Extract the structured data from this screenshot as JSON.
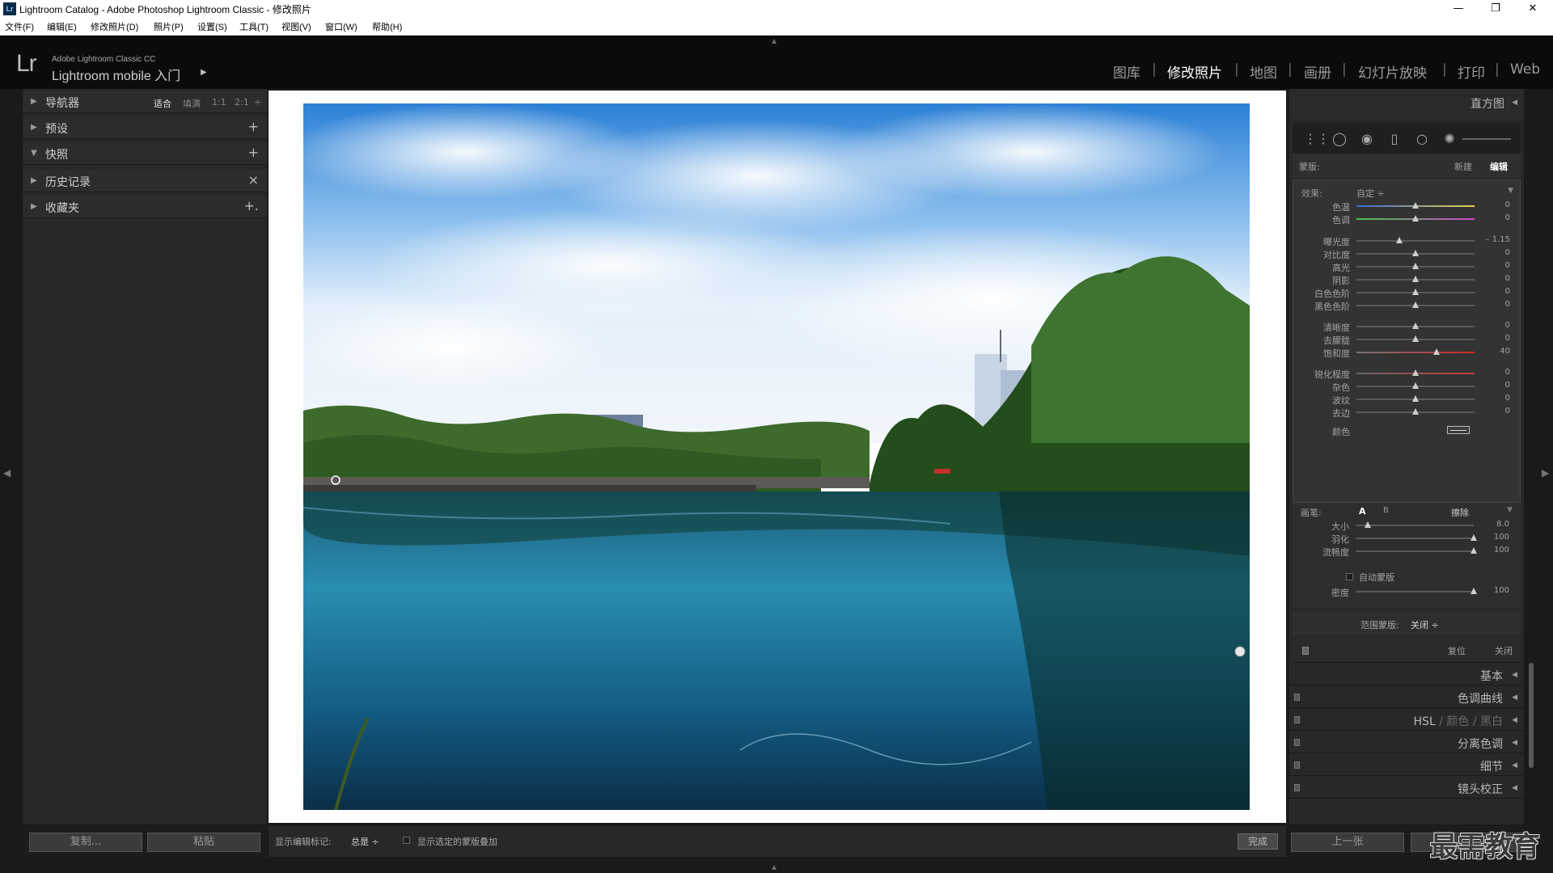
{
  "window": {
    "title": "Lightroom Catalog - Adobe Photoshop Lightroom Classic - 修改照片",
    "app_icon": "Lr",
    "minimize": "—",
    "maximize": "❐",
    "close": "✕"
  },
  "menubar": [
    "文件(F)",
    "编辑(E)",
    "修改照片(D)",
    "照片(P)",
    "设置(S)",
    "工具(T)",
    "视图(V)",
    "窗口(W)",
    "帮助(H)"
  ],
  "identity": {
    "logo": "Lr",
    "product": "Adobe Lightroom Classic CC",
    "mobile": "Lightroom mobile 入门",
    "caret": "▶"
  },
  "modules": [
    "图库",
    "修改照片",
    "地图",
    "画册",
    "幻灯片放映",
    "打印",
    "Web"
  ],
  "active_module": "修改照片",
  "left_panel": {
    "navigator": {
      "label": "导航器",
      "options": [
        "适合",
        "填满",
        "1:1",
        "2:1"
      ],
      "active": "适合",
      "spinner": "÷"
    },
    "presets": {
      "label": "预设",
      "action": "+"
    },
    "snapshots": {
      "label": "快照",
      "action": "+"
    },
    "history": {
      "label": "历史记录",
      "action": "×"
    },
    "collections": {
      "label": "收藏夹",
      "action": "+."
    },
    "copy_button": "复制...",
    "paste_button": "粘贴"
  },
  "toolbar": {
    "show_edit_pins_label": "显示编辑标记:",
    "show_edit_pins_value": "总是 ÷",
    "show_overlay_label": "显示选定的蒙版叠加",
    "done_button": "完成"
  },
  "right_panel": {
    "histogram_label": "直方图",
    "mask": {
      "label": "蒙版:",
      "new": "新建",
      "edit": "编辑"
    },
    "effect": {
      "label": "效果:",
      "value": "自定 ÷"
    },
    "sliders": [
      {
        "label": "色温",
        "value": "0",
        "pos": 0.5
      },
      {
        "label": "色调",
        "value": "0",
        "pos": 0.5
      },
      {
        "label": "曝光度",
        "value": "– 1.15",
        "pos": 0.36
      },
      {
        "label": "对比度",
        "value": "0",
        "pos": 0.5
      },
      {
        "label": "高光",
        "value": "0",
        "pos": 0.5
      },
      {
        "label": "阴影",
        "value": "0",
        "pos": 0.5
      },
      {
        "label": "白色色阶",
        "value": "0",
        "pos": 0.5
      },
      {
        "label": "黑色色阶",
        "value": "0",
        "pos": 0.5
      },
      {
        "label": "清晰度",
        "value": "0",
        "pos": 0.5
      },
      {
        "label": "去朦胧",
        "value": "0",
        "pos": 0.5
      },
      {
        "label": "饱和度",
        "value": "40",
        "pos": 0.68
      },
      {
        "label": "锐化程度",
        "value": "0",
        "pos": 0.5
      },
      {
        "label": "杂色",
        "value": "0",
        "pos": 0.5
      },
      {
        "label": "波纹",
        "value": "0",
        "pos": 0.5
      },
      {
        "label": "去边",
        "value": "0",
        "pos": 0.5
      }
    ],
    "color_label": "颜色",
    "brush": {
      "label": "画笔:",
      "a": "A",
      "b": "B",
      "erase": "擦除",
      "sliders": [
        {
          "label": "大小",
          "value": "8.0",
          "pos": 0.1
        },
        {
          "label": "羽化",
          "value": "100",
          "pos": 1.0
        },
        {
          "label": "流畅度",
          "value": "100",
          "pos": 1.0
        },
        {
          "label": "密度",
          "value": "100",
          "pos": 1.0
        }
      ],
      "auto_mask": "自动蒙版"
    },
    "range_mask": {
      "label": "范围蒙版:",
      "value": "关闭 ÷"
    },
    "reset": "复位",
    "close": "关闭",
    "sections": [
      {
        "label": "基本"
      },
      {
        "label": "色调曲线"
      },
      {
        "label": "HSL",
        "extra": [
          "颜色",
          "黑白"
        ],
        "sep": "/"
      },
      {
        "label": "分离色调"
      },
      {
        "label": "细节"
      },
      {
        "label": "镜头校正"
      }
    ],
    "prev_button": "上一张"
  },
  "watermark": "最需教育"
}
